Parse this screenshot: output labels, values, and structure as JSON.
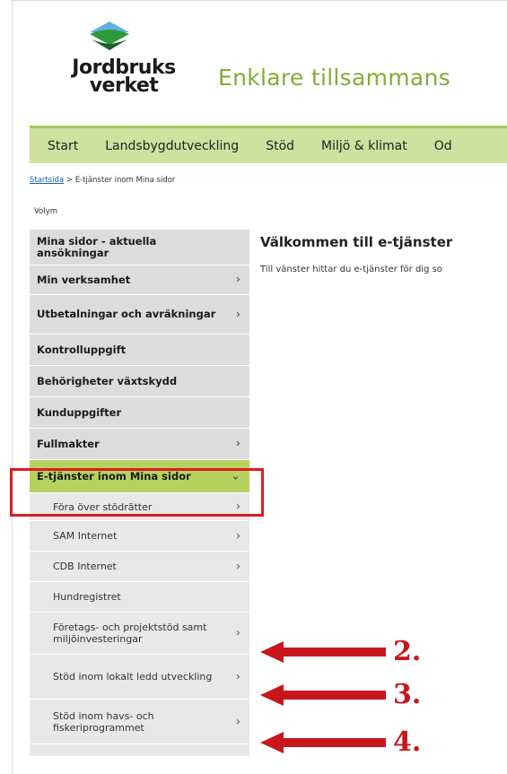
{
  "header": {
    "logo_line1": "Jordbruks",
    "logo_line2": "verket",
    "tagline": "Enklare tillsammans"
  },
  "nav": {
    "items": [
      "Start",
      "Landsbygdutveckling",
      "Stöd",
      "Miljö & klimat",
      "Od"
    ]
  },
  "breadcrumb": {
    "home": "Startsida",
    "separator": ">",
    "current": "E-tjänster inom Mina sidor"
  },
  "volym_label": "Volym",
  "sidebar": {
    "items": [
      {
        "label": "Mina sidor - aktuella ansökningar",
        "chevron": ""
      },
      {
        "label": "Min verksamhet",
        "chevron": "›"
      },
      {
        "label": "Utbetalningar och avräkningar",
        "chevron": "›"
      },
      {
        "label": "Kontrolluppgift",
        "chevron": ""
      },
      {
        "label": "Behörigheter växtskydd",
        "chevron": ""
      },
      {
        "label": "Kunduppgifter",
        "chevron": ""
      },
      {
        "label": "Fullmakter",
        "chevron": "›"
      },
      {
        "label": "E-tjänster inom Mina sidor",
        "chevron": "⌄"
      }
    ],
    "subitems": [
      {
        "label": "Föra över stödrätter",
        "chevron": "›"
      },
      {
        "label": "SAM Internet",
        "chevron": "›"
      },
      {
        "label": "CDB Internet",
        "chevron": "›"
      },
      {
        "label": "Hundregistret",
        "chevron": ""
      },
      {
        "label": "Företags- och projektstöd samt miljöinvesteringar",
        "chevron": "›"
      },
      {
        "label": "Stöd inom lokalt ledd utveckling",
        "chevron": "›"
      },
      {
        "label": "Stöd inom havs- och fiskeriprogrammet",
        "chevron": "›"
      }
    ]
  },
  "main": {
    "title": "Välkommen till e-tjänster",
    "text": "Till vänster hittar du e-tjänster för dig so"
  },
  "annotations": {
    "labels": [
      "2.",
      "3.",
      "4."
    ],
    "color": "#c8161d"
  },
  "colors": {
    "brand_green": "#7fae34",
    "nav_bg": "#cfe19e",
    "active_bg": "#b5d25e",
    "highlight": "#e11b22"
  }
}
